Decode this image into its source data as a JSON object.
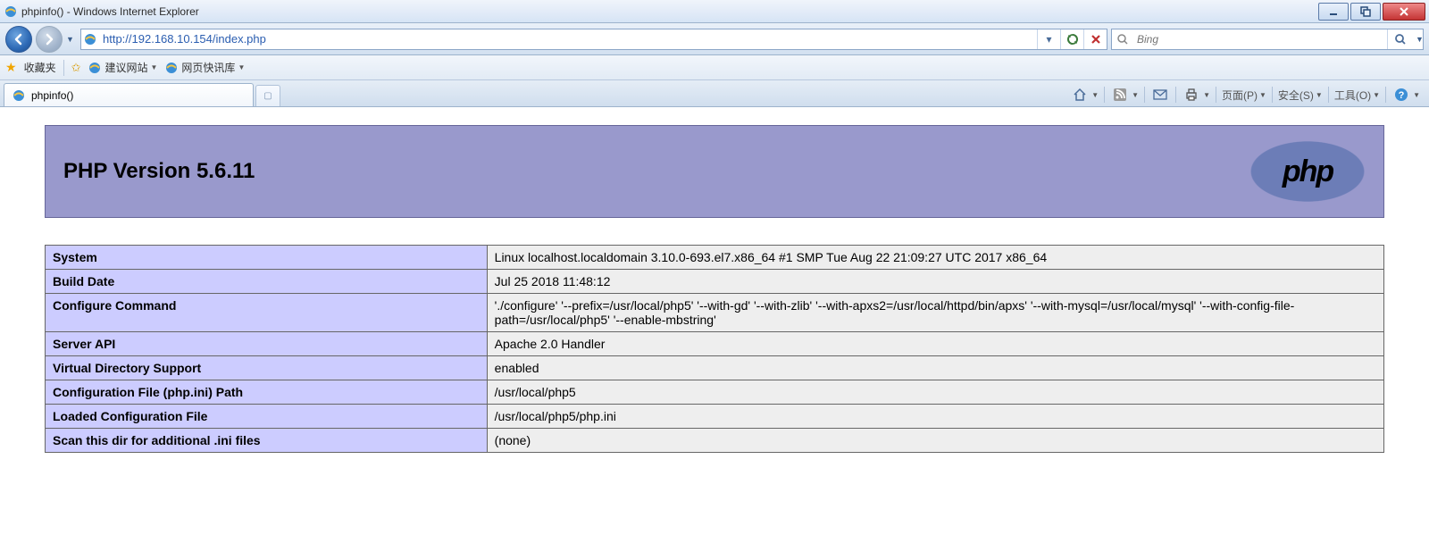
{
  "window": {
    "title": "phpinfo() - Windows Internet Explorer"
  },
  "nav": {
    "url": "http://192.168.10.154/index.php",
    "search_placeholder": "Bing"
  },
  "favbar": {
    "favorites_label": "收藏夹",
    "suggested_label": "建议网站",
    "slice_label": "网页快讯库"
  },
  "tab": {
    "title": "phpinfo()"
  },
  "toolbar": {
    "page_label": "页面(P)",
    "safety_label": "安全(S)",
    "tools_label": "工具(O)"
  },
  "phpinfo": {
    "header_title": "PHP Version 5.6.11",
    "logo_text": "php",
    "rows": [
      {
        "k": "System",
        "v": "Linux localhost.localdomain 3.10.0-693.el7.x86_64 #1 SMP Tue Aug 22 21:09:27 UTC 2017 x86_64"
      },
      {
        "k": "Build Date",
        "v": "Jul 25 2018 11:48:12"
      },
      {
        "k": "Configure Command",
        "v": "'./configure' '--prefix=/usr/local/php5' '--with-gd' '--with-zlib' '--with-apxs2=/usr/local/httpd/bin/apxs' '--with-mysql=/usr/local/mysql' '--with-config-file-path=/usr/local/php5' '--enable-mbstring'"
      },
      {
        "k": "Server API",
        "v": "Apache 2.0 Handler"
      },
      {
        "k": "Virtual Directory Support",
        "v": "enabled"
      },
      {
        "k": "Configuration File (php.ini) Path",
        "v": "/usr/local/php5"
      },
      {
        "k": "Loaded Configuration File",
        "v": "/usr/local/php5/php.ini"
      },
      {
        "k": "Scan this dir for additional .ini files",
        "v": "(none)"
      }
    ]
  }
}
